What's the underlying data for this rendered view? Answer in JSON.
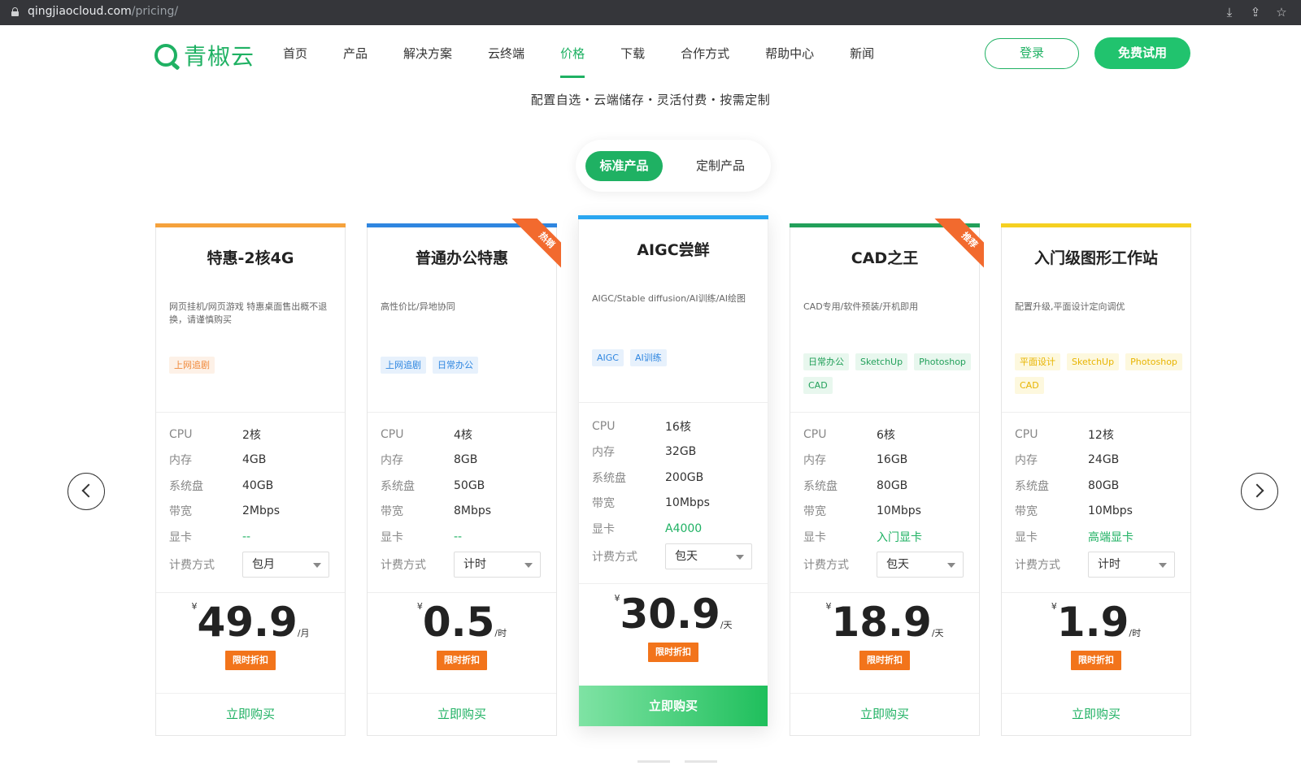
{
  "browser": {
    "url_host": "qingjiaocloud.com",
    "url_path": "/pricing/"
  },
  "header": {
    "logo_text": "青椒云",
    "nav": [
      "首页",
      "产品",
      "解决方案",
      "云终端",
      "价格",
      "下载",
      "合作方式",
      "帮助中心",
      "新闻"
    ],
    "active_nav": "价格",
    "login": "登录",
    "trial": "免费试用"
  },
  "tagline": "配置自选・云端储存・灵活付费・按需定制",
  "tabs": {
    "standard": "标准产品",
    "custom": "定制产品"
  },
  "colors": {
    "brand": "#1fb163",
    "badge": "#f2741b"
  },
  "spec_labels": {
    "cpu": "CPU",
    "mem": "内存",
    "disk": "系统盘",
    "bw": "带宽",
    "gpu": "显卡",
    "billing": "计费方式"
  },
  "cards": [
    {
      "title": "特惠-2核4G",
      "desc": "网页挂机/网页游戏 特惠桌面售出概不退换，请谨慎购买",
      "tags": [
        {
          "label": "上网追剧",
          "color": "orange"
        }
      ],
      "cpu": "2核",
      "mem": "4GB",
      "disk": "40GB",
      "bw": "2Mbps",
      "gpu": "--",
      "billing": "包月",
      "currency": "¥",
      "price": "49.9",
      "unit": "/月",
      "badge": "限时折扣",
      "buy": "立即购买",
      "ribbon": ""
    },
    {
      "title": "普通办公特惠",
      "desc": "高性价比/异地协同",
      "tags": [
        {
          "label": "上网追剧",
          "color": "blue"
        },
        {
          "label": "日常办公",
          "color": "blue"
        }
      ],
      "cpu": "4核",
      "mem": "8GB",
      "disk": "50GB",
      "bw": "8Mbps",
      "gpu": "--",
      "billing": "计时",
      "currency": "¥",
      "price": "0.5",
      "unit": "/时",
      "badge": "限时折扣",
      "buy": "立即购买",
      "ribbon": "热销"
    },
    {
      "title": "AIGC尝鲜",
      "desc": "AIGC/Stable diffusion/AI训练/AI绘图",
      "tags": [
        {
          "label": "AIGC",
          "color": "blue"
        },
        {
          "label": "AI训练",
          "color": "blue"
        }
      ],
      "cpu": "16核",
      "mem": "32GB",
      "disk": "200GB",
      "bw": "10Mbps",
      "gpu": "A4000",
      "billing": "包天",
      "currency": "¥",
      "price": "30.9",
      "unit": "/天",
      "badge": "限时折扣",
      "buy": "立即购买",
      "ribbon": ""
    },
    {
      "title": "CAD之王",
      "desc": "CAD专用/软件预装/开机即用",
      "tags": [
        {
          "label": "日常办公",
          "color": "green"
        },
        {
          "label": "SketchUp",
          "color": "green"
        },
        {
          "label": "Photoshop",
          "color": "green"
        },
        {
          "label": "CAD",
          "color": "green"
        }
      ],
      "cpu": "6核",
      "mem": "16GB",
      "disk": "80GB",
      "bw": "10Mbps",
      "gpu": "入门显卡",
      "billing": "包天",
      "currency": "¥",
      "price": "18.9",
      "unit": "/天",
      "badge": "限时折扣",
      "buy": "立即购买",
      "ribbon": "推荐"
    },
    {
      "title": "入门级图形工作站",
      "desc": "配置升级,平面设计定向调优",
      "tags": [
        {
          "label": "平面设计",
          "color": "yellow"
        },
        {
          "label": "SketchUp",
          "color": "yellow"
        },
        {
          "label": "Photoshop",
          "color": "yellow"
        },
        {
          "label": "CAD",
          "color": "yellow"
        }
      ],
      "cpu": "12核",
      "mem": "24GB",
      "disk": "80GB",
      "bw": "10Mbps",
      "gpu": "高端显卡",
      "billing": "计时",
      "currency": "¥",
      "price": "1.9",
      "unit": "/时",
      "badge": "限时折扣",
      "buy": "立即购买",
      "ribbon": ""
    }
  ]
}
